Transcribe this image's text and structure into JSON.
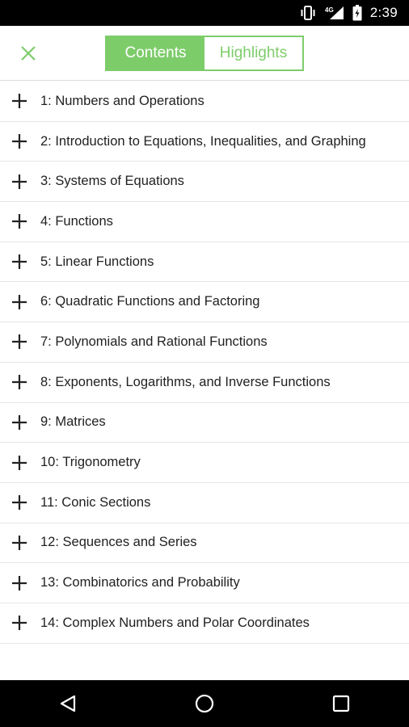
{
  "status_bar": {
    "time": "2:39",
    "icons": [
      "vibrate-icon",
      "signal-4g-icon",
      "battery-icon"
    ]
  },
  "header": {
    "close_icon": "close-icon",
    "tabs": [
      {
        "label": "Contents",
        "active": true
      },
      {
        "label": "Highlights",
        "active": false
      }
    ],
    "accent_color": "#7dcc6a"
  },
  "chapters": [
    {
      "label": "1: Numbers and Operations"
    },
    {
      "label": "2: Introduction to Equations, Inequalities, and Graphing"
    },
    {
      "label": "3: Systems of Equations"
    },
    {
      "label": "4: Functions"
    },
    {
      "label": "5: Linear Functions"
    },
    {
      "label": "6: Quadratic Functions and Factoring"
    },
    {
      "label": "7: Polynomials and Rational Functions"
    },
    {
      "label": "8: Exponents, Logarithms, and Inverse Functions"
    },
    {
      "label": "9: Matrices"
    },
    {
      "label": "10: Trigonometry"
    },
    {
      "label": "11: Conic Sections"
    },
    {
      "label": "12: Sequences and Series"
    },
    {
      "label": "13: Combinatorics and Probability"
    },
    {
      "label": "14: Complex Numbers and Polar Coordinates"
    }
  ],
  "nav_bar": {
    "buttons": [
      "back-icon",
      "home-icon",
      "recents-icon"
    ]
  }
}
